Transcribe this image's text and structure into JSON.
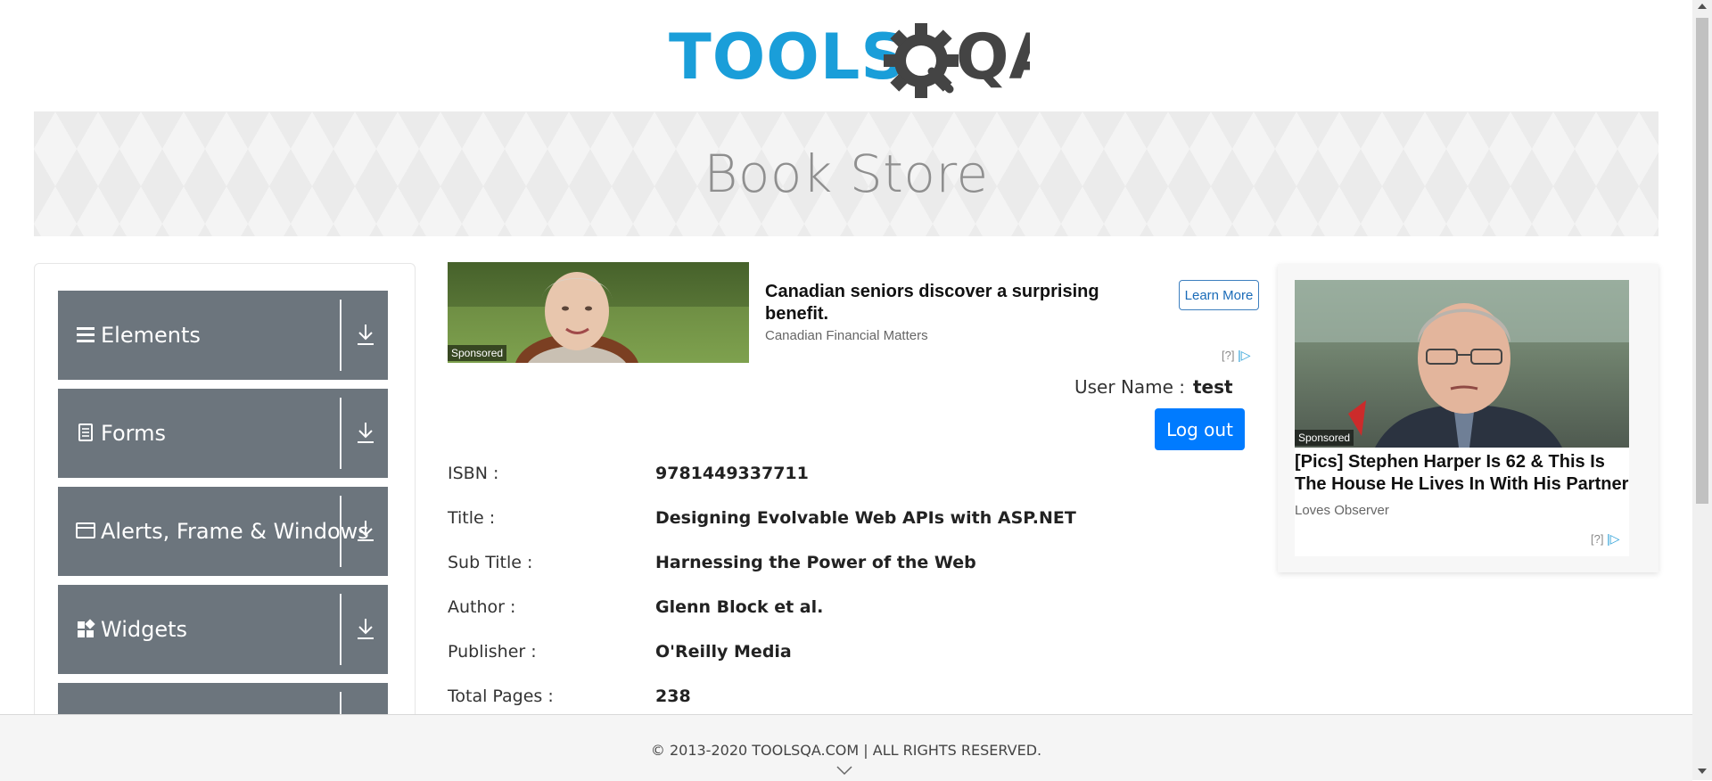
{
  "logo": {
    "text_blue": "TOOLS",
    "text_dark": "QA"
  },
  "header": {
    "title": "Book Store"
  },
  "sidebar": {
    "items": [
      {
        "label": "Elements",
        "icon": "hamburger-icon"
      },
      {
        "label": "Forms",
        "icon": "document-icon"
      },
      {
        "label": "Alerts, Frame & Windows",
        "icon": "window-icon"
      },
      {
        "label": "Widgets",
        "icon": "widgets-icon"
      },
      {
        "label": "",
        "icon": ""
      }
    ]
  },
  "ad_top": {
    "sponsored": "Sponsored",
    "title": "Canadian seniors discover a surprising benefit.",
    "source": "Canadian Financial Matters",
    "cta": "Learn More",
    "adchoice": "[?]"
  },
  "user": {
    "label": "User Name :",
    "value": "test",
    "logout": "Log out"
  },
  "book": {
    "rows": [
      {
        "label": "ISBN :",
        "value": "9781449337711"
      },
      {
        "label": "Title :",
        "value": "Designing Evolvable Web APIs with ASP.NET"
      },
      {
        "label": "Sub Title :",
        "value": "Harnessing the Power of the Web"
      },
      {
        "label": "Author :",
        "value": "Glenn Block et al."
      },
      {
        "label": "Publisher :",
        "value": "O'Reilly Media"
      },
      {
        "label": "Total Pages :",
        "value": "238"
      }
    ]
  },
  "ad_right": {
    "sponsored": "Sponsored",
    "title": "[Pics] Stephen Harper Is 62 & This Is The House He Lives In With His Partner",
    "source": "Loves Observer",
    "adchoice": "[?]"
  },
  "footer": {
    "copyright": "© 2013-2020 TOOLSQA.COM | ALL RIGHTS RESERVED."
  },
  "colors": {
    "sidebar_item": "#6c757d",
    "primary_button": "#007bff",
    "logo_blue": "#1a9ed9",
    "logo_dark": "#444444"
  }
}
